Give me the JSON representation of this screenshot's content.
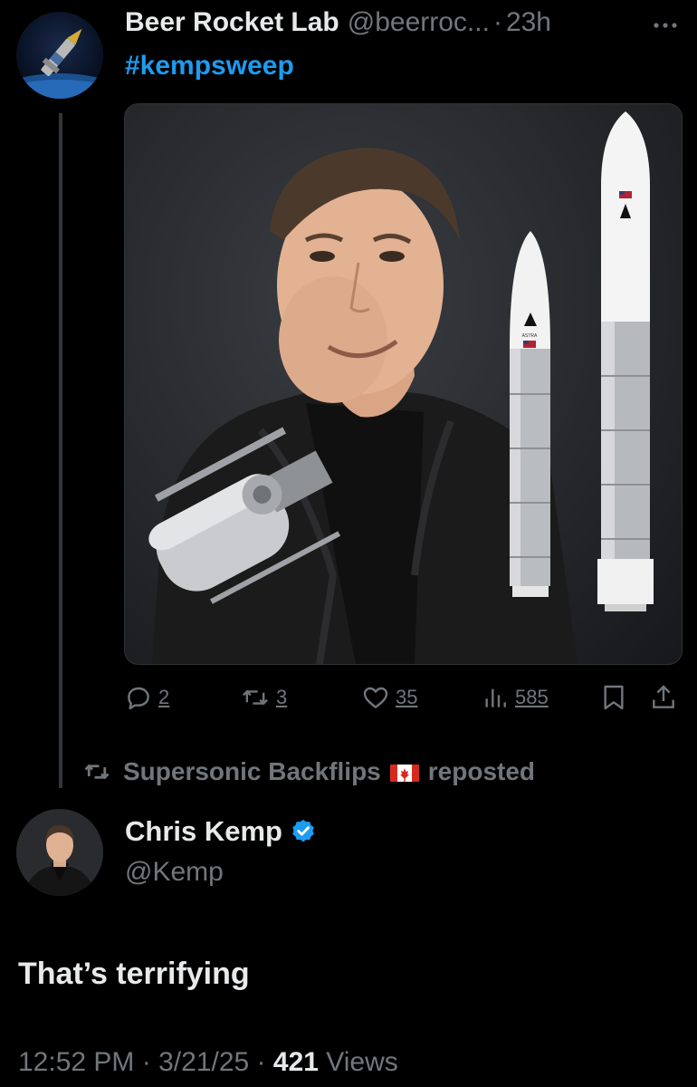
{
  "tweet": {
    "author_name": "Beer Rocket Lab",
    "author_handle": "@beerroc...",
    "dot": "·",
    "time": "23h",
    "hashtag": "#kempsweep",
    "media_label": "ASTRA",
    "actions": {
      "replies": "2",
      "reposts": "3",
      "likes": "35",
      "views": "585"
    }
  },
  "repost_notice": {
    "name": "Supersonic Backflips",
    "suffix": "reposted"
  },
  "reply": {
    "author_name": "Chris Kemp",
    "author_handle": "@Kemp",
    "text": "That’s terrifying",
    "time": "12:52 PM",
    "dot1": "·",
    "date": "3/21/25",
    "dot2": "·",
    "views_count": "421",
    "views_label": "Views"
  },
  "icons": {
    "more": "more-dots-icon",
    "reply": "reply-icon",
    "repost": "repost-icon",
    "like": "heart-icon",
    "views": "views-bar-icon",
    "bookmark": "bookmark-icon",
    "share": "share-icon",
    "verified": "verified-badge-icon"
  },
  "colors": {
    "background": "#000000",
    "accent": "#1d9bf0",
    "secondary_text": "#71767b",
    "primary_text": "#e7e9ea"
  }
}
